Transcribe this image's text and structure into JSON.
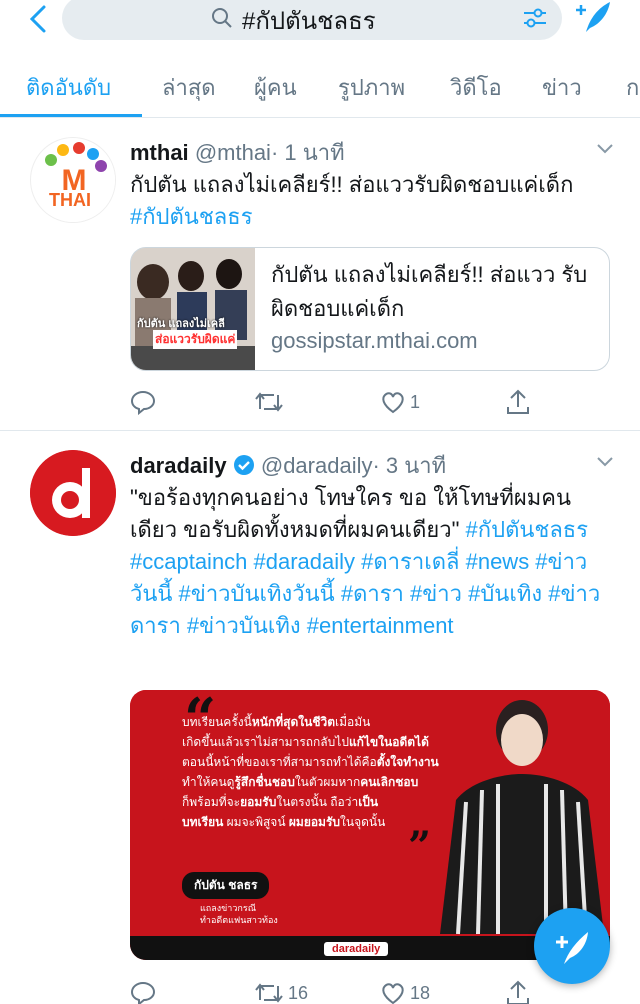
{
  "search": {
    "query": "#กัปตันชลธร"
  },
  "tabs": [
    "ติดอันดับ",
    "ล่าสุด",
    "ผู้คน",
    "รูปภาพ",
    "วิดีโอ",
    "ข่าว",
    "ก"
  ],
  "tweets": [
    {
      "name": "mthai",
      "handle": "@mthai",
      "time": "· 1 นาที",
      "text": "กัปตัน แถลงไม่เคลียร์!! ส่อแววรับผิดชอบแค่เด็ก",
      "hashtags": [
        "#กัปตันชลธร"
      ],
      "card": {
        "title": "กัปตัน แถลงไม่เคลียร์!! ส่อแวว รับผิดชอบแค่เด็ก",
        "domain": "gossipstar.mthai.com",
        "thumb_text_1": "กัปตัน แถลงไม่เคลี",
        "thumb_text_2": "ส่อแววรับผิดแค่"
      },
      "avatar_text": "THAI",
      "likes": "1"
    },
    {
      "name": "daradaily",
      "handle": "@daradaily",
      "time": "· 3 นาที",
      "text_1": "\"ขอร้องทุกคนอย่าง โทษใคร ขอ ให้โทษที่ผมคน เดียว ขอรับผิดทั้งหมดที่ผมคนเดียว\"",
      "text_tags": "#กัปตันชลธร #ccaptainch #daradaily #ดาราเดลี่ #news #ข่าววันนี้ #ข่าวบันเทิงวันนี้ #ดารา #ข่าว #บันเทิง #ข่าวดารา #ข่าวบันเทิง #entertainment",
      "media": {
        "quote_1": "บทเรียนครั้งนี้",
        "quote_1b": "หนักที่สุดในชีวิต",
        "quote_1c": "เมื่อมัน",
        "quote_2": "เกิดขึ้นแล้วเราไม่สามารถกลับไป",
        "quote_2b": "แก้ไขในอดีตได้",
        "quote_3": "ตอนนี้หน้าที่ของเราที่สามารถทำได้คือ",
        "quote_3b": "ตั้งใจทำงาน",
        "quote_4": "ทำให้คนดู",
        "quote_4b": "รู้สึกชื่นชอบ",
        "quote_4c": "ในตัวผมหาก",
        "quote_4d": "คนเลิกชอบ",
        "quote_5": "ก็พร้อมที่จะ",
        "quote_5b": "ยอมรับ",
        "quote_5c": "ในตรงนั้น ถือว่า",
        "quote_5d": "เป็น",
        "quote_6": "บทเรียน",
        "quote_6b": " ผมจะพิสูจน์ ",
        "quote_6c": "ผมยอมรับ",
        "quote_6d": "ในจุดนั้น",
        "person": "กัปตัน ชลธร",
        "person_sub_1": "แถลงข่าวกรณี",
        "person_sub_2": "ทำอดีตแฟนสาวท้อง",
        "brand": "daradaily"
      },
      "retweets": "16",
      "likes": "18"
    }
  ],
  "colors": {
    "accent": "#1da1f2",
    "muted": "#657786",
    "media_red": "#c7141c"
  }
}
